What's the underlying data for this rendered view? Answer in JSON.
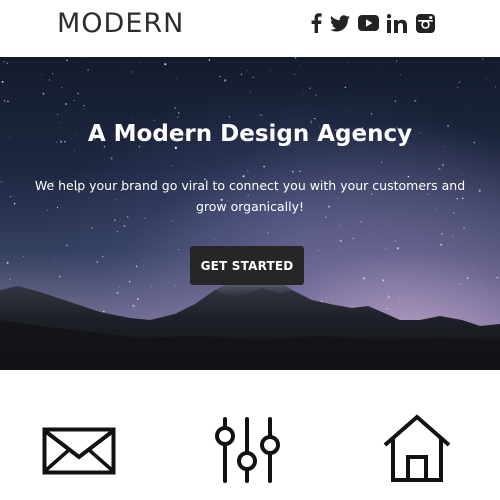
{
  "header": {
    "logo": "MODERN",
    "social_icons": [
      "facebook-icon",
      "twitter-icon",
      "youtube-icon",
      "linkedin-icon",
      "instagram-icon"
    ]
  },
  "hero": {
    "title": "A Modern Design Agency",
    "subtitle": "We help your brand go viral to connect you with your customers and grow organically!",
    "cta_label": "GET STARTED"
  },
  "features": {
    "icons": [
      "mail-icon",
      "sliders-icon",
      "home-icon"
    ]
  },
  "colors": {
    "text_dark": "#2d2d2d",
    "button_bg": "#262626",
    "white": "#ffffff"
  }
}
